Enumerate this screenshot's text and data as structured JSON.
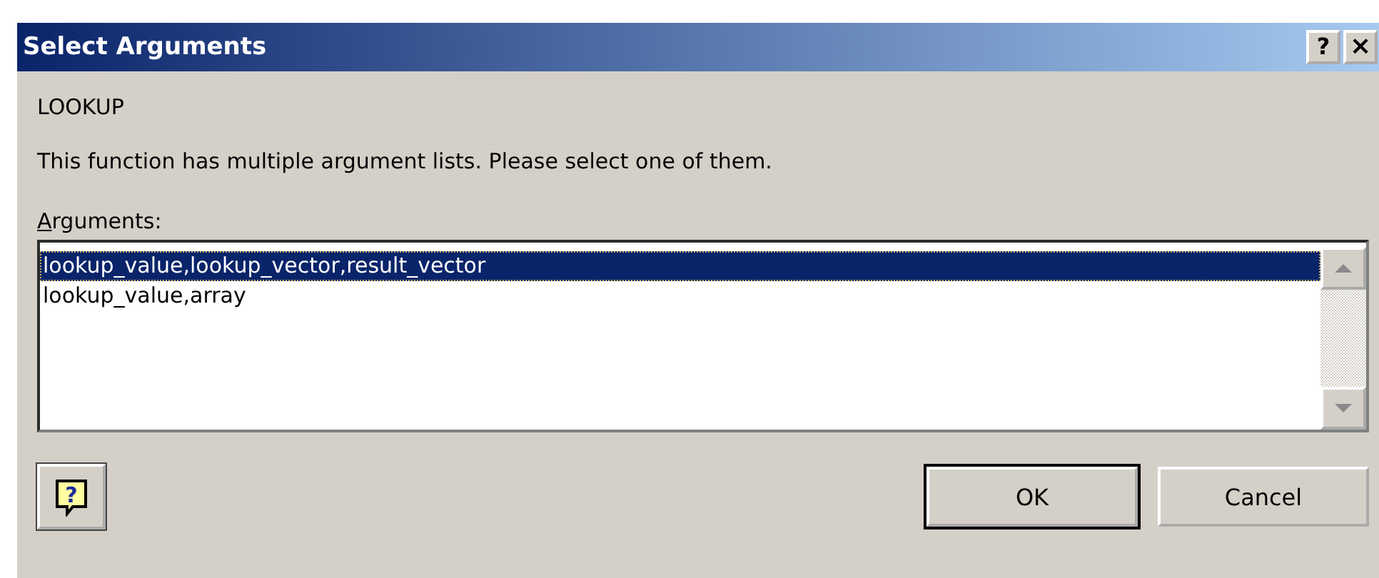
{
  "window": {
    "title": "Select Arguments",
    "title_buttons": [
      {
        "kind": "help",
        "label": "?"
      },
      {
        "kind": "close",
        "label": "×"
      }
    ]
  },
  "function_name": "LOOKUP",
  "description": "This function has multiple argument lists.  Please select one of them.",
  "list_label": {
    "text": "Arguments:"
  },
  "help_button": {
    "label": "?"
  },
  "arguments": [
    {
      "label": "lookup_value,lookup_vector,result_vector",
      "selected": true
    },
    {
      "label": "lookup_value,array",
      "selected": false
    }
  ],
  "buttons": [
    {
      "label": "OK",
      "default": true
    },
    {
      "label": "Cancel",
      "default": false
    }
  ]
}
